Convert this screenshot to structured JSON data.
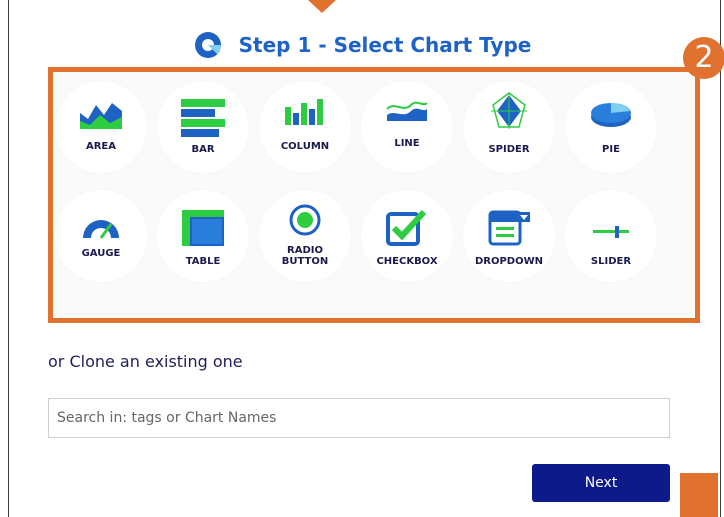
{
  "header": {
    "title": "Step 1 - Select Chart Type"
  },
  "step_badge": "2",
  "chart_types": [
    {
      "id": "area",
      "label": "AREA"
    },
    {
      "id": "bar",
      "label": "BAR"
    },
    {
      "id": "column",
      "label": "COLUMN"
    },
    {
      "id": "line",
      "label": "LINE"
    },
    {
      "id": "spider",
      "label": "SPIDER"
    },
    {
      "id": "pie",
      "label": "PIE"
    },
    {
      "id": "gauge",
      "label": "GAUGE"
    },
    {
      "id": "table",
      "label": "TABLE"
    },
    {
      "id": "radio",
      "label": "RADIO BUTTON"
    },
    {
      "id": "checkbox",
      "label": "CHECKBOX"
    },
    {
      "id": "dropdown",
      "label": "DROPDOWN"
    },
    {
      "id": "slider",
      "label": "SLIDER"
    }
  ],
  "clone": {
    "text": "or Clone an existing one"
  },
  "search": {
    "placeholder": "Search in: tags or Chart Names",
    "value": ""
  },
  "actions": {
    "next_label": "Next"
  },
  "colors": {
    "accent": "#e0712f",
    "title": "#1e63c4",
    "button": "#0d1a8a",
    "icon_blue": "#1e63c4",
    "icon_green": "#2ecc40"
  },
  "icons": {
    "logo": "app-logo-icon",
    "area": "area-chart-icon",
    "bar": "bar-chart-icon",
    "column": "column-chart-icon",
    "line": "line-chart-icon",
    "spider": "spider-chart-icon",
    "pie": "pie-chart-icon",
    "gauge": "gauge-icon",
    "table": "table-icon",
    "radio": "radio-button-icon",
    "checkbox": "checkbox-icon",
    "dropdown": "dropdown-icon",
    "slider": "slider-icon"
  }
}
